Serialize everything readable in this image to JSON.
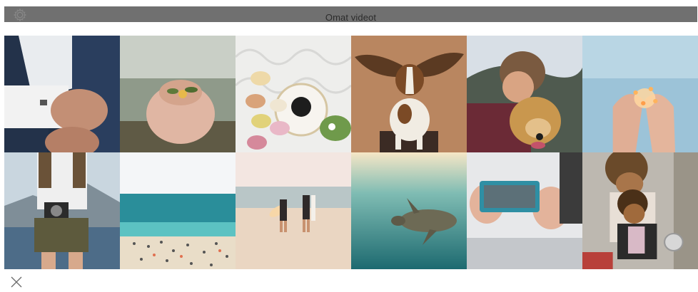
{
  "window": {
    "title": "Omat videot",
    "settings_icon": "gear-icon",
    "close_icon": "close-icon"
  },
  "colors": {
    "titlebar_bg": "#707070",
    "title_text": "#2b2b2b",
    "page_bg": "#ffffff"
  },
  "tiles": [
    {
      "name": "suit-cufflinks"
    },
    {
      "name": "hands-holding-flower"
    },
    {
      "name": "macarons-coffee"
    },
    {
      "name": "dog-flying-ears"
    },
    {
      "name": "man-hugging-dog"
    },
    {
      "name": "hands-fairy-lights"
    },
    {
      "name": "woman-camera-lake"
    },
    {
      "name": "crowded-beach"
    },
    {
      "name": "surfers-beach"
    },
    {
      "name": "sea-turtle"
    },
    {
      "name": "phone-photo-hands"
    },
    {
      "name": "mother-daughter-scooter"
    }
  ]
}
